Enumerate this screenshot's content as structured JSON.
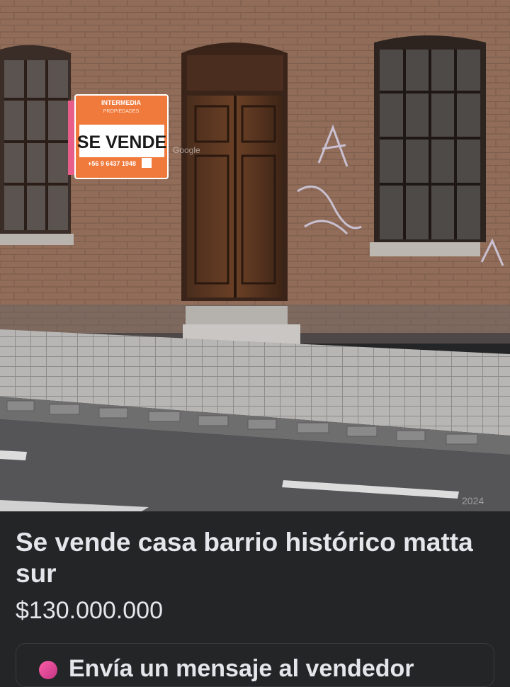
{
  "listing": {
    "title": "Se vende casa barrio histórico matta sur",
    "price": "$130.000.000",
    "message_preview": "Envía un mensaje al vendedor"
  },
  "photo": {
    "sign": {
      "company": "INTERMEDIA",
      "subtitle": "PROPIEDADES",
      "headline": "SE VENDE",
      "phone": "+56 9 6437 1948"
    },
    "watermark": "Google",
    "year_watermark": "2024"
  },
  "colors": {
    "background": "#242526",
    "text": "#e4e6eb",
    "sign_orange": "#f07a3c"
  }
}
